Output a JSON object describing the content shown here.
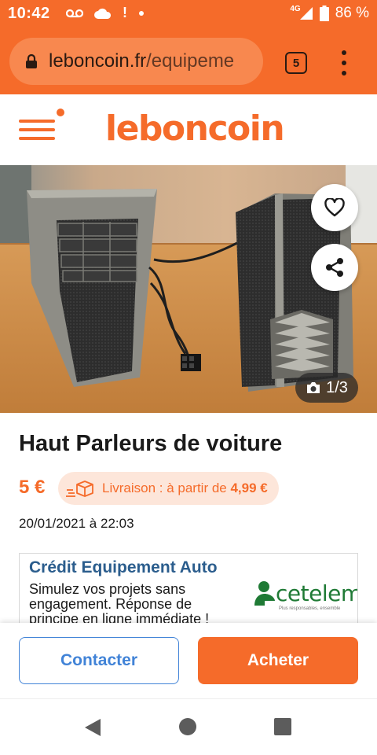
{
  "status_bar": {
    "time": "10:42",
    "network": "4G",
    "battery": "86 %",
    "icons": [
      "voicemail-icon",
      "cloud-icon",
      "alert-icon",
      "dot-icon",
      "signal-icon",
      "battery-icon"
    ]
  },
  "browser": {
    "url_host": "leboncoin.fr",
    "url_path": "/equipeme",
    "tab_count": "5"
  },
  "header": {
    "logo": "leboncoin"
  },
  "listing": {
    "title": "Haut Parleurs de voiture",
    "price": "5 €",
    "delivery_prefix": "Livraison : à partir de ",
    "delivery_price": "4,99 €",
    "date": "20/01/2021 à 22:03",
    "photo_counter": "1/3"
  },
  "ad": {
    "title": "Crédit Equipement Auto",
    "text": "Simulez vos projets sans engagement. Réponse de principe en ligne immédiate !",
    "brand": "cetelem",
    "brand_tagline": "Plus responsables, ensemble"
  },
  "actions": {
    "contact": "Contacter",
    "buy": "Acheter"
  },
  "colors": {
    "brand_orange": "#f56b2a",
    "link_blue": "#4183d7",
    "ad_title_blue": "#2b5d8d",
    "cetelem_green": "#1f7a35"
  }
}
